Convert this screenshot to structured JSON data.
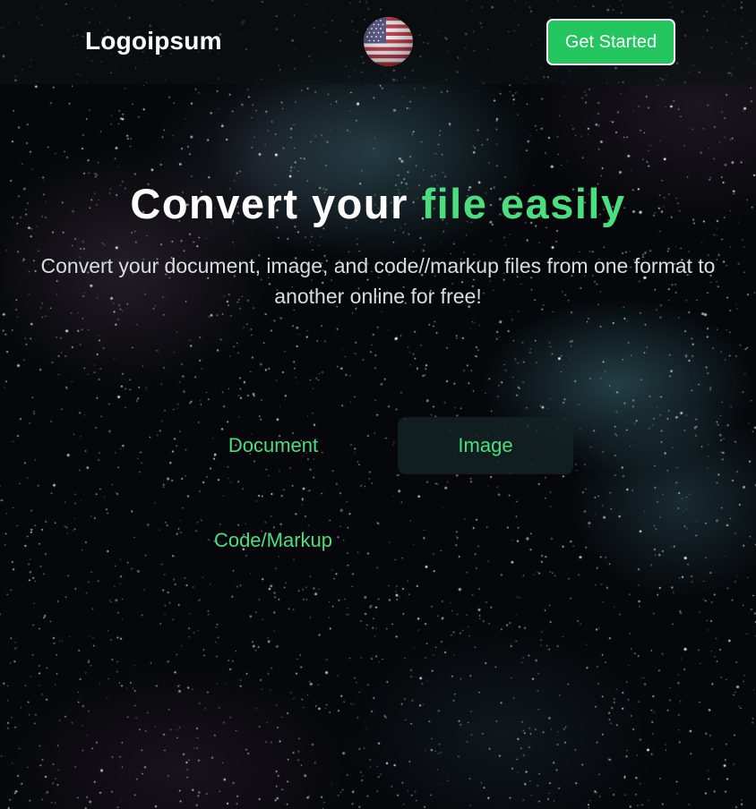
{
  "header": {
    "logo_text": "Logoipsum",
    "language_flag_icon": "us-flag-icon",
    "cta_label": "Get Started"
  },
  "hero": {
    "title_white": "Convert your ",
    "title_accent": "file easily",
    "subtitle": "Convert your document, image, and code//markup files from one format to another online for free!"
  },
  "tabs": [
    {
      "label": "Document",
      "selected": false
    },
    {
      "label": "Image",
      "selected": true
    },
    {
      "label": "Code/Markup",
      "selected": false
    }
  ],
  "colors": {
    "accent": "#22c55e",
    "accent_text": "#4ade80",
    "background": "#05070a"
  }
}
